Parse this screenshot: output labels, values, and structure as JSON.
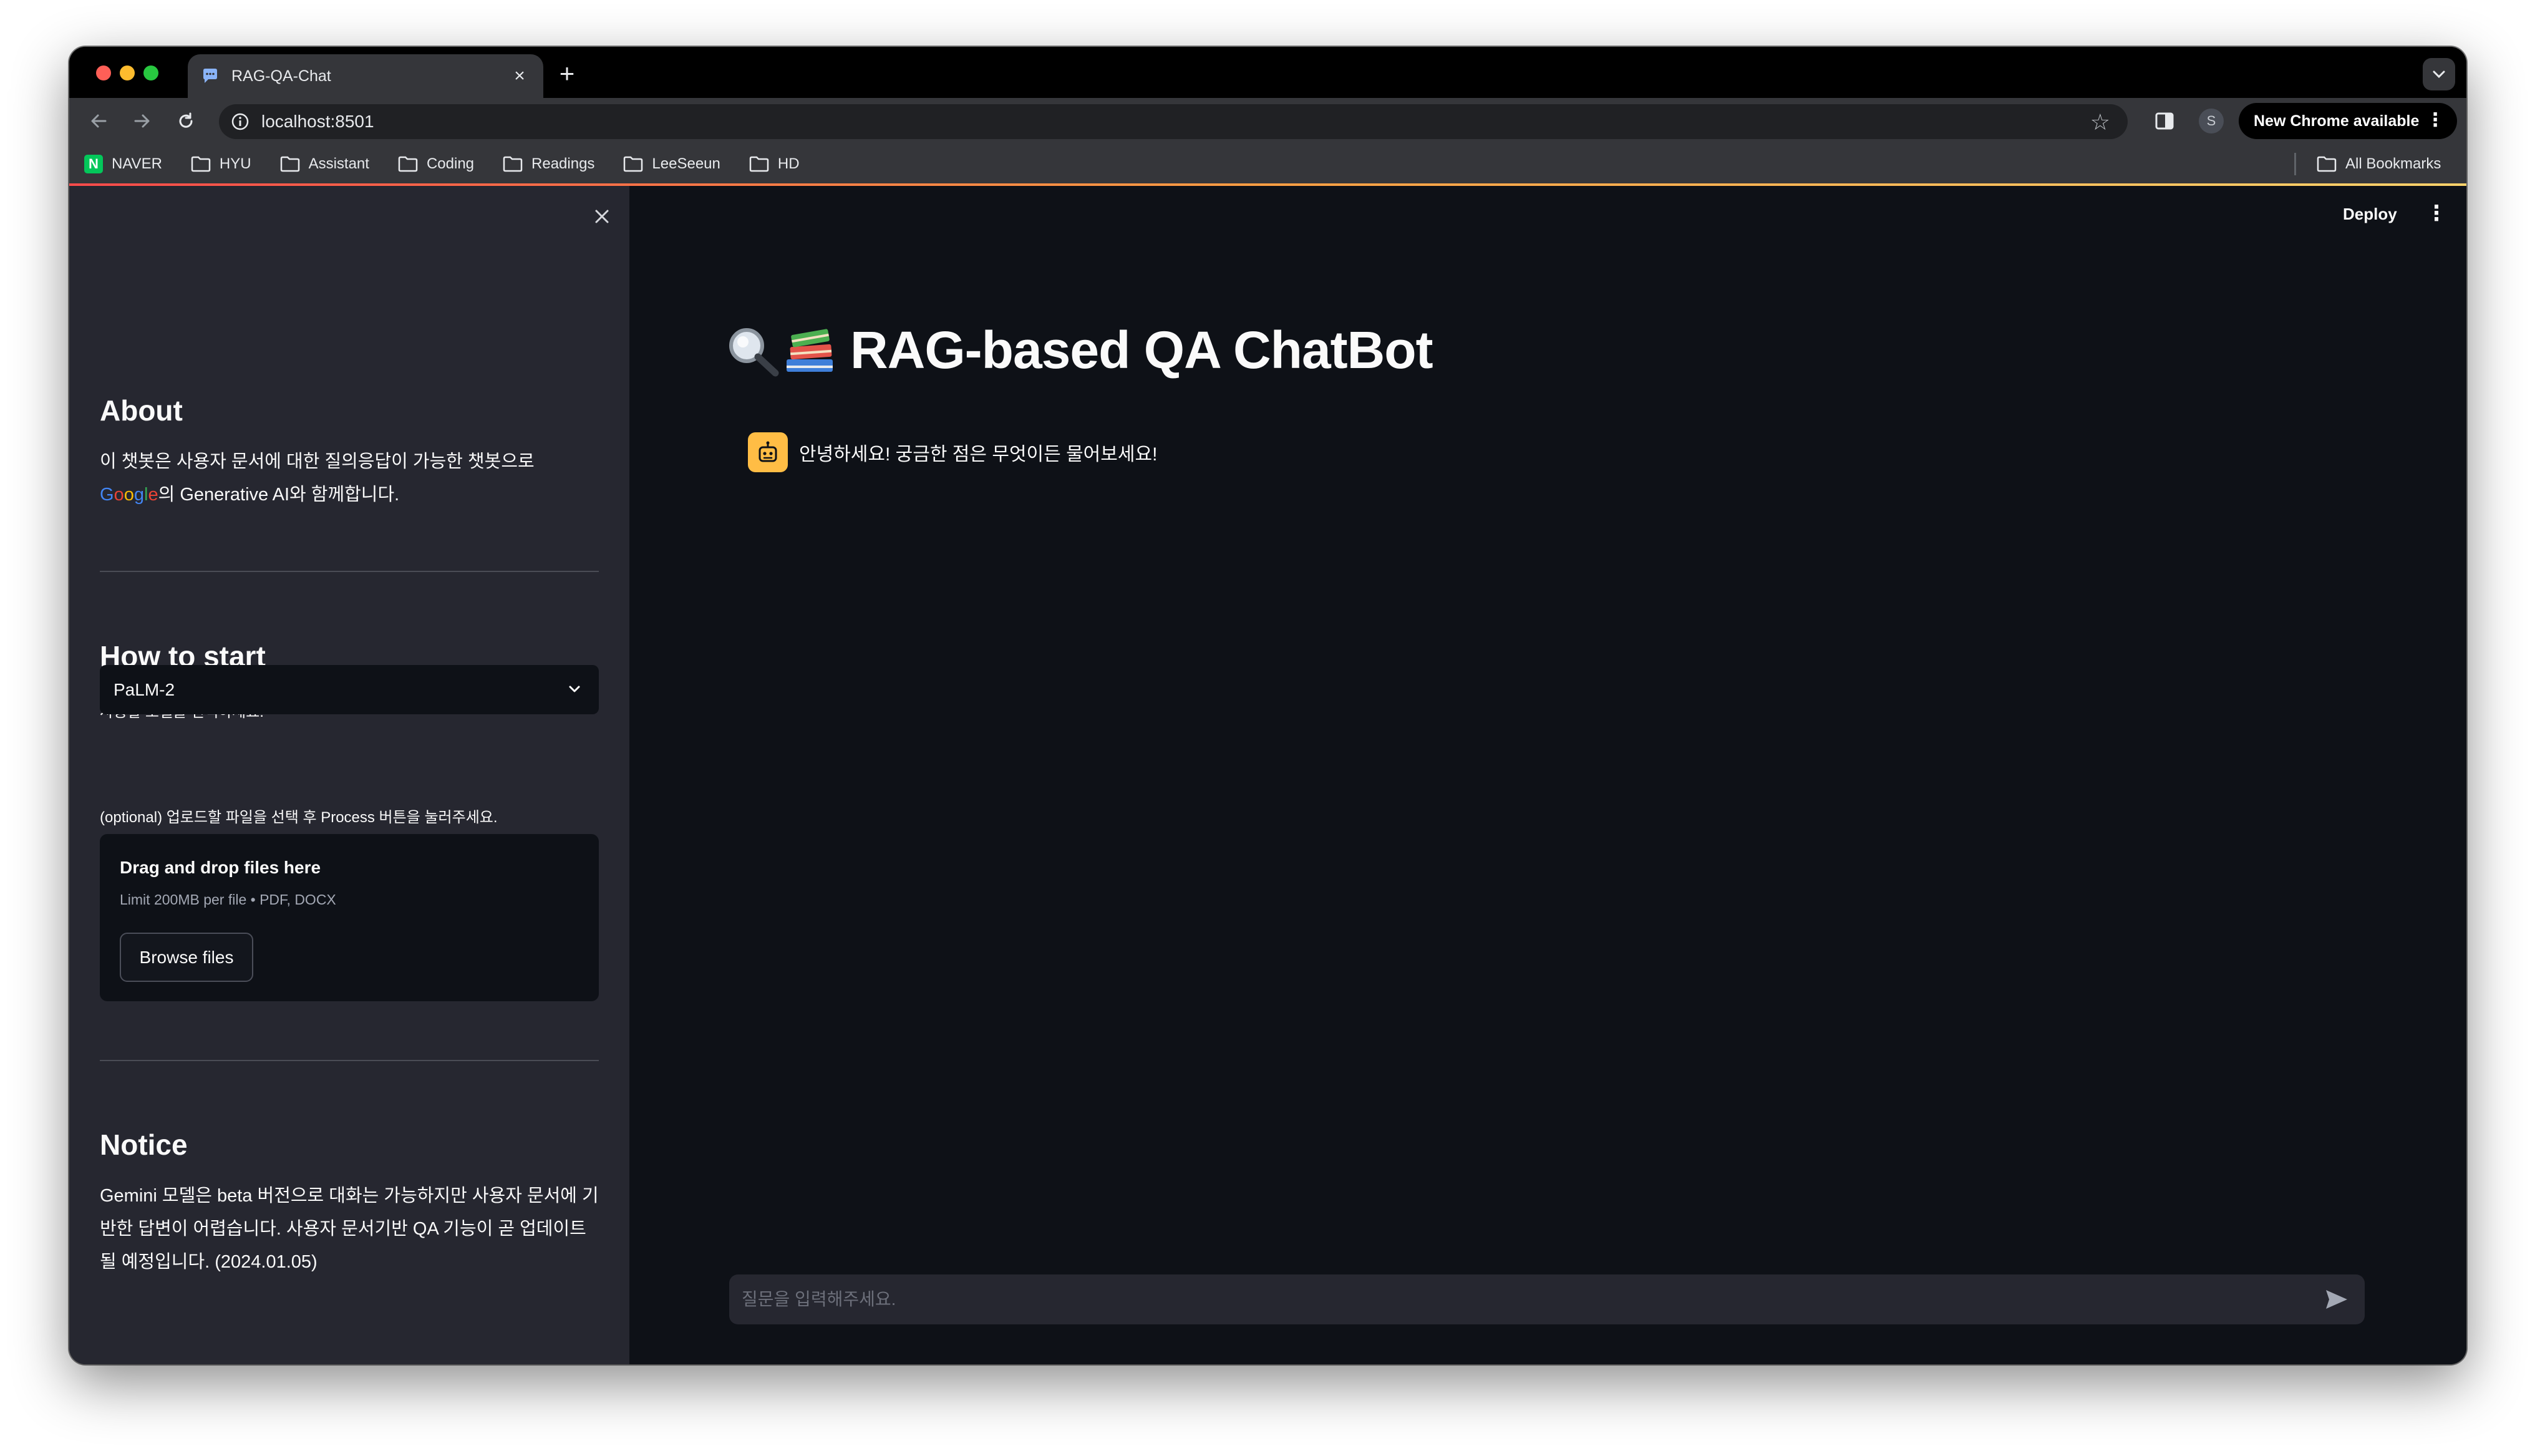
{
  "browser": {
    "tab_title": "RAG-QA-Chat",
    "tab_close": "×",
    "new_tab": "+",
    "url": "localhost:8501",
    "profile_initial": "S",
    "update_button": "New Chrome available",
    "bookmarks": [
      "NAVER",
      "HYU",
      "Assistant",
      "Coding",
      "Readings",
      "LeeSeeun",
      "HD"
    ],
    "all_bookmarks": "All Bookmarks"
  },
  "sidebar": {
    "about_heading": "About",
    "about_line1": "이 챗봇은 사용자 문서에 대한 질의응답이 가능한 챗봇으로",
    "about_google_letters": [
      {
        "ch": "G",
        "color": "#4285f4"
      },
      {
        "ch": "o",
        "color": "#ea4335"
      },
      {
        "ch": "o",
        "color": "#fbbc05"
      },
      {
        "ch": "g",
        "color": "#4285f4"
      },
      {
        "ch": "l",
        "color": "#34a853"
      },
      {
        "ch": "e",
        "color": "#ea4335"
      }
    ],
    "about_line2_rest": "의 Generative AI와 함께합니다.",
    "howto_heading": "How to start",
    "model_label": "사용할 모델을 선택하세요.",
    "model_selected": "PaLM-2",
    "upload_label": "(optional) 업로드할 파일을 선택 후 Process 버튼을 눌러주세요.",
    "upload_title": "Drag and drop files here",
    "upload_limit": "Limit 200MB per file • PDF, DOCX",
    "browse_button": "Browse files",
    "notice_heading": "Notice",
    "notice_text": "Gemini 모델은 beta 버전으로 대화는 가능하지만 사용자 문서에 기반한 답변이 어렵습니다. 사용자 문서기반 QA 기능이 곧 업데이트될 예정입니다. (2024.01.05)"
  },
  "main": {
    "deploy": "Deploy",
    "kebab": "⋮",
    "title": "RAG-based QA ChatBot",
    "assistant_message": "안녕하세요! 궁금한 점은 무엇이든 물어보세요!",
    "input_placeholder": "질문을 입력해주세요."
  },
  "colors": {
    "accent_gradient": [
      "#ff4b4b",
      "#ff9f43",
      "#ffd36b"
    ],
    "sidebar_bg": "#262730",
    "main_bg": "#0e1117",
    "bot_avatar": "#ffbd45"
  },
  "icons": {
    "title_emojis": [
      "magnifying-glass-icon",
      "books-icon"
    ],
    "bot_avatar": "robot-face-icon"
  }
}
